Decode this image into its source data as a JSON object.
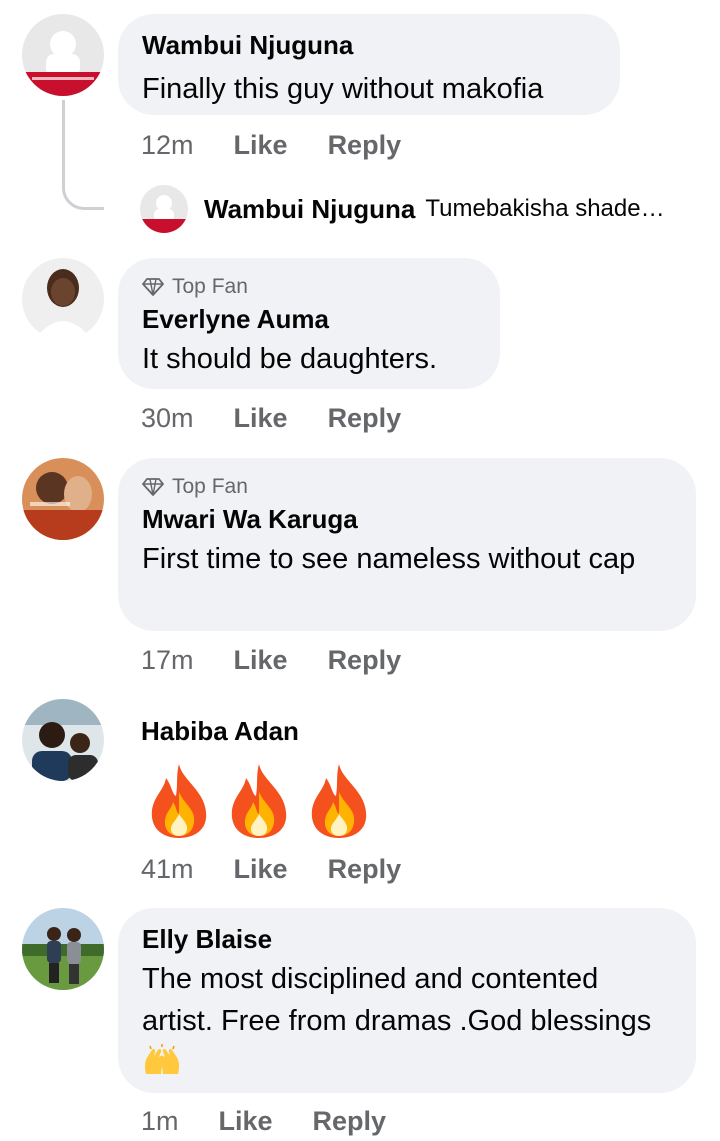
{
  "comments": [
    {
      "author": "Wambui Njuguna",
      "text": "Finally this guy without makofia",
      "time": "12m",
      "like": "Like",
      "reply": "Reply",
      "reply_preview": {
        "author": "Wambui Njuguna",
        "text": "Tumebakisha shade…"
      }
    },
    {
      "badge": "Top Fan",
      "author": "Everlyne Auma",
      "text": "It should be daughters.",
      "time": "30m",
      "like": "Like",
      "reply": "Reply"
    },
    {
      "badge": "Top Fan",
      "author": "Mwari Wa Karuga",
      "text": "First time to see nameless without cap",
      "time": "17m",
      "like": "Like",
      "reply": "Reply"
    },
    {
      "author": "Habiba Adan",
      "emojis": [
        "fire-emoji",
        "fire-emoji",
        "fire-emoji"
      ],
      "time": "41m",
      "like": "Like",
      "reply": "Reply"
    },
    {
      "author": "Elly Blaise",
      "text": "The most disciplined  and contented artist. Free from dramas .God blessings",
      "trailing_emoji": "raising-hands-emoji",
      "time": "1m",
      "like": "Like",
      "reply": "Reply"
    }
  ],
  "colors": {
    "bubble": "#f0f2f5",
    "meta": "#65676b",
    "text": "#050505",
    "thread_line": "#ced0d4"
  }
}
